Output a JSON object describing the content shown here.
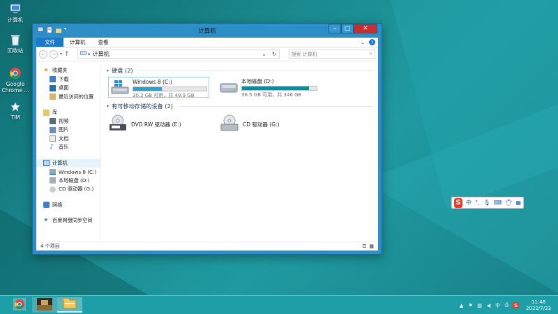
{
  "desktop": {
    "icons": [
      {
        "label": "计算机",
        "icon": "computer-icon"
      },
      {
        "label": "回收站",
        "icon": "recycle-bin-icon"
      },
      {
        "label": "Google Chrome ...",
        "icon": "chrome-icon"
      },
      {
        "label": "TIM",
        "icon": "tim-icon"
      }
    ]
  },
  "window": {
    "title": "计算机",
    "controls": {
      "minimize": "–",
      "maximize": "□",
      "close": "✕"
    },
    "ribbon": {
      "tabs": [
        "文件",
        "计算机",
        "查看"
      ]
    },
    "nav": {
      "back": "←",
      "forward": "→",
      "up": "↑"
    },
    "address": {
      "path": "计算机",
      "refresh": "↻"
    },
    "search": {
      "placeholder": "搜索 计算机"
    },
    "sidebar": {
      "favorites_title": "收藏夹",
      "favorites": [
        "下载",
        "桌面",
        "最近访问的位置"
      ],
      "libraries_title": "库",
      "libraries": [
        "视频",
        "图片",
        "文档",
        "音乐"
      ],
      "computer_title": "计算机",
      "computer_items": [
        "Windows 8 (C:)",
        "本地磁盘 (D:)",
        "CD 驱动器 (G:)"
      ],
      "network": "网络",
      "baidu": "百度网盘同步空间"
    },
    "hard_disks": {
      "title": "硬盘 (2)",
      "drives": [
        {
          "name": "Windows 8 (C:)",
          "capacity": "30.2 GB 可用，共 49.9 GB",
          "used_fraction": 0.395
        },
        {
          "name": "本地磁盘 (D:)",
          "capacity": "36.5 GB 可用，共 346 GB",
          "used_fraction": 0.895
        }
      ]
    },
    "removable": {
      "title": "有可移动存储的设备 (2)",
      "devices": [
        {
          "name": "DVD RW 驱动器 (E:)",
          "icon": "dvd-drive-icon"
        },
        {
          "name": "CD 驱动器 (G:)",
          "icon": "cd-drive-icon"
        }
      ]
    },
    "status": {
      "count": "4 个项目"
    }
  },
  "ime": {
    "mode": "中",
    "logo": "S"
  },
  "taskbar": {
    "items": [
      "chrome-icon",
      "photo-viewer-icon",
      "file-explorer-icon"
    ],
    "clock": {
      "time": "11:46",
      "date": "2022/7/23"
    }
  },
  "colors": {
    "accent": "#2c8fc8",
    "taskbar": "#1e9ea6",
    "close": "#c7302a",
    "bar": "#26a0da"
  }
}
